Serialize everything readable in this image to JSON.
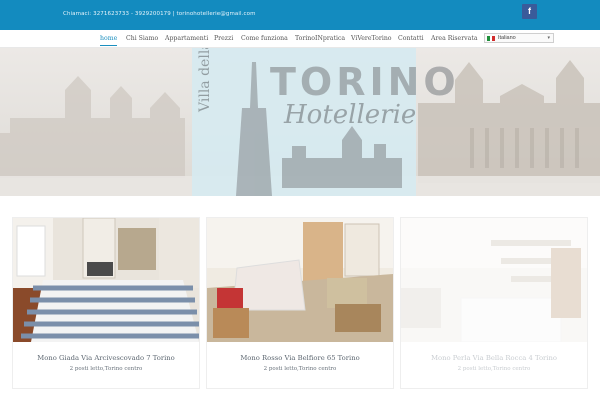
{
  "header": {
    "contact": "Chiamaci: 3271623733 - 3929200179  |  torinohotellerie@gmail.com",
    "social_icon": "facebook-icon",
    "social_glyph": "f"
  },
  "nav": {
    "items": [
      {
        "label": "home",
        "active": true
      },
      {
        "label": "Chi Siamo"
      },
      {
        "label": "Appartamenti"
      },
      {
        "label": "Prezzi"
      },
      {
        "label": "Come funziona"
      },
      {
        "label": "TorinoINpratica"
      },
      {
        "label": "ViVereTorino"
      },
      {
        "label": "Contatti"
      },
      {
        "label": "Area Riservata"
      }
    ],
    "language": {
      "selected": "Italiano",
      "flag_icon": "italy-flag-icon"
    }
  },
  "hero": {
    "logo_word": "TORINO",
    "logo_script": "Hotellerie",
    "logo_vertical": "Villa della Vittoria"
  },
  "listings": [
    {
      "title": "Mono Giada Via Arcivescovado 7 Torino",
      "subtitle": "2 posti letto,Torino centro"
    },
    {
      "title": "Mono Rosso Via Belfiore 65 Torino",
      "subtitle": "2 posti letto,Torino centro"
    },
    {
      "title": "Mono Perla Via Bella Rocca 4 Torino",
      "subtitle": "2 posti letto,Torino centro"
    }
  ],
  "colors": {
    "topbar": "#138bbf",
    "accent": "#1b8fbf",
    "facebook": "#3a5b9a"
  }
}
